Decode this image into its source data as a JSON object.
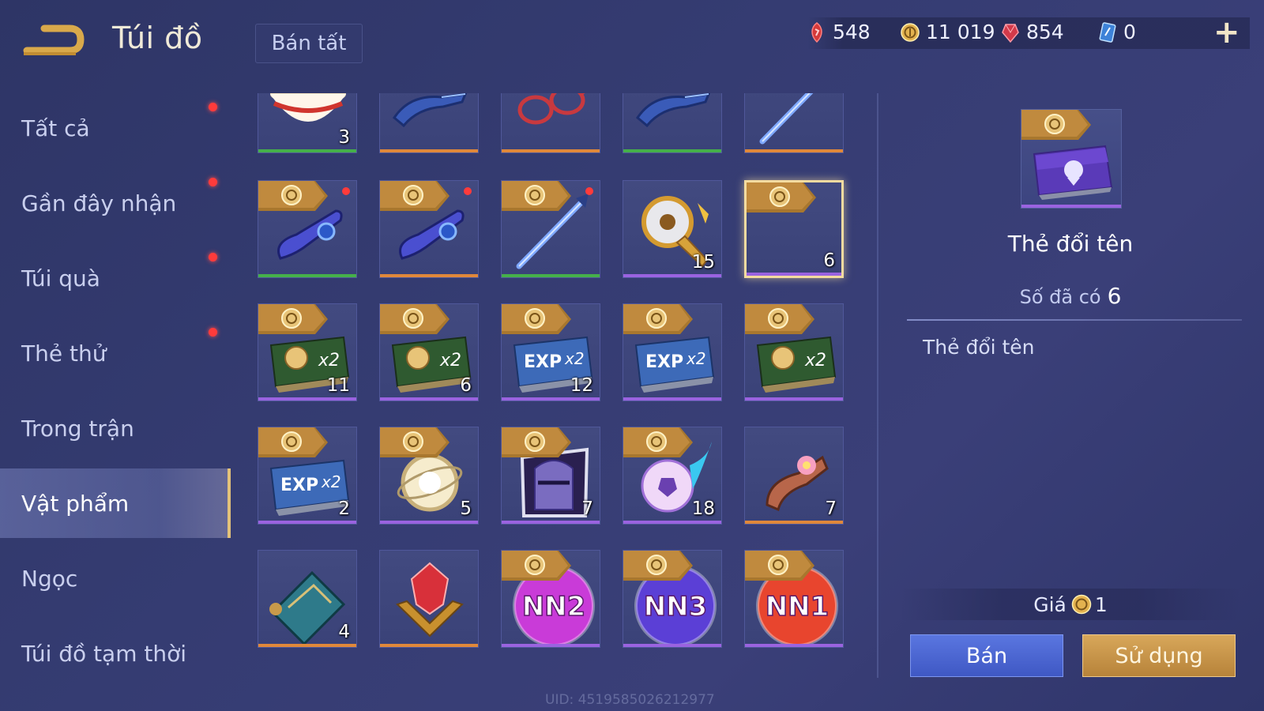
{
  "header": {
    "title": "Túi đồ",
    "sell_all_label": "Bán tất",
    "currencies": [
      {
        "icon": "red-gem-icon",
        "value": "548"
      },
      {
        "icon": "gold-coin-icon",
        "value": "11 019"
      },
      {
        "icon": "ruby-icon",
        "value": "854"
      },
      {
        "icon": "blue-card-icon",
        "value": "0"
      }
    ],
    "plus_label": "+"
  },
  "sidebar": {
    "items": [
      {
        "label": "Tất cả",
        "dot": true
      },
      {
        "label": "Gần đây nhận",
        "dot": true
      },
      {
        "label": "Túi quà",
        "dot": true
      },
      {
        "label": "Thẻ thử",
        "dot": true
      },
      {
        "label": "Trong trận",
        "dot": false
      },
      {
        "label": "Vật phẩm",
        "dot": false,
        "active": true
      },
      {
        "label": "Ngọc",
        "dot": false
      },
      {
        "label": "Túi đồ tạm thời",
        "dot": false
      }
    ]
  },
  "grid": {
    "rows": [
      [
        {
          "icon": "noodle-bowl-icon",
          "qty": "3",
          "rarity": "green"
        },
        {
          "icon": "blue-weapon-icon",
          "qty": "",
          "rarity": "orange"
        },
        {
          "icon": "red-glasses-icon",
          "qty": "",
          "rarity": "orange"
        },
        {
          "icon": "blue-weapon-icon",
          "qty": "",
          "rarity": "green"
        },
        {
          "icon": "blue-sword-icon",
          "qty": "",
          "rarity": "orange"
        }
      ],
      [
        {
          "icon": "blue-headset-icon",
          "qty": "",
          "rarity": "green",
          "badge": true,
          "dot": true
        },
        {
          "icon": "blue-headset-icon",
          "qty": "",
          "rarity": "orange",
          "badge": true,
          "dot": true
        },
        {
          "icon": "blue-sword-icon",
          "qty": "",
          "rarity": "green",
          "badge": true,
          "dot": true
        },
        {
          "icon": "golden-trophy-icon",
          "qty": "15",
          "rarity": "purple"
        },
        {
          "icon": "rename-card-icon",
          "qty": "6",
          "rarity": "purple",
          "badge": true,
          "selected": true
        }
      ],
      [
        {
          "icon": "gold-x2-card-icon",
          "qty": "11",
          "rarity": "purple",
          "badge": true
        },
        {
          "icon": "gold-x2-card-icon",
          "qty": "6",
          "rarity": "purple",
          "badge": true
        },
        {
          "icon": "exp-x2-card-icon",
          "qty": "12",
          "rarity": "purple",
          "badge": true
        },
        {
          "icon": "exp-x2-card-icon",
          "qty": "",
          "rarity": "purple",
          "badge": true
        },
        {
          "icon": "gold-x2-card-icon",
          "qty": "",
          "rarity": "purple",
          "badge": true
        }
      ],
      [
        {
          "icon": "exp-x2-card-icon",
          "qty": "2",
          "rarity": "purple",
          "badge": true
        },
        {
          "icon": "light-orb-icon",
          "qty": "5",
          "rarity": "purple",
          "badge": true
        },
        {
          "icon": "knight-helmet-icon",
          "qty": "7",
          "rarity": "purple",
          "badge": true
        },
        {
          "icon": "soccer-ball-icon",
          "qty": "18",
          "rarity": "purple",
          "badge": true
        },
        {
          "icon": "flower-scroll-icon",
          "qty": "7",
          "rarity": "orange"
        }
      ],
      [
        {
          "icon": "map-scroll-icon",
          "qty": "4",
          "rarity": "orange"
        },
        {
          "icon": "red-crest-icon",
          "qty": "",
          "rarity": "orange"
        },
        {
          "icon": "nn2-badge-icon",
          "qty": "",
          "rarity": "purple",
          "badge": true,
          "text": "NN2",
          "color": "#c93bd8"
        },
        {
          "icon": "nn3-badge-icon",
          "qty": "",
          "rarity": "purple",
          "badge": true,
          "text": "NN3",
          "color": "#5b3fd6"
        },
        {
          "icon": "nn1-badge-icon",
          "qty": "",
          "rarity": "purple",
          "badge": true,
          "text": "NN1",
          "color": "#e8452e"
        }
      ]
    ],
    "rarity_colors": {
      "green": "#45b04a",
      "orange": "#e0883a",
      "purple": "#9a63e0"
    }
  },
  "detail": {
    "name": "Thẻ đổi tên",
    "owned_label": "Số đã có",
    "owned_value": "6",
    "description": "Thẻ đổi tên",
    "price_label": "Giá",
    "price_value": "1",
    "sell_label": "Bán",
    "use_label": "Sử dụng"
  },
  "footer": {
    "uid": "UID: 4519585026212977"
  }
}
